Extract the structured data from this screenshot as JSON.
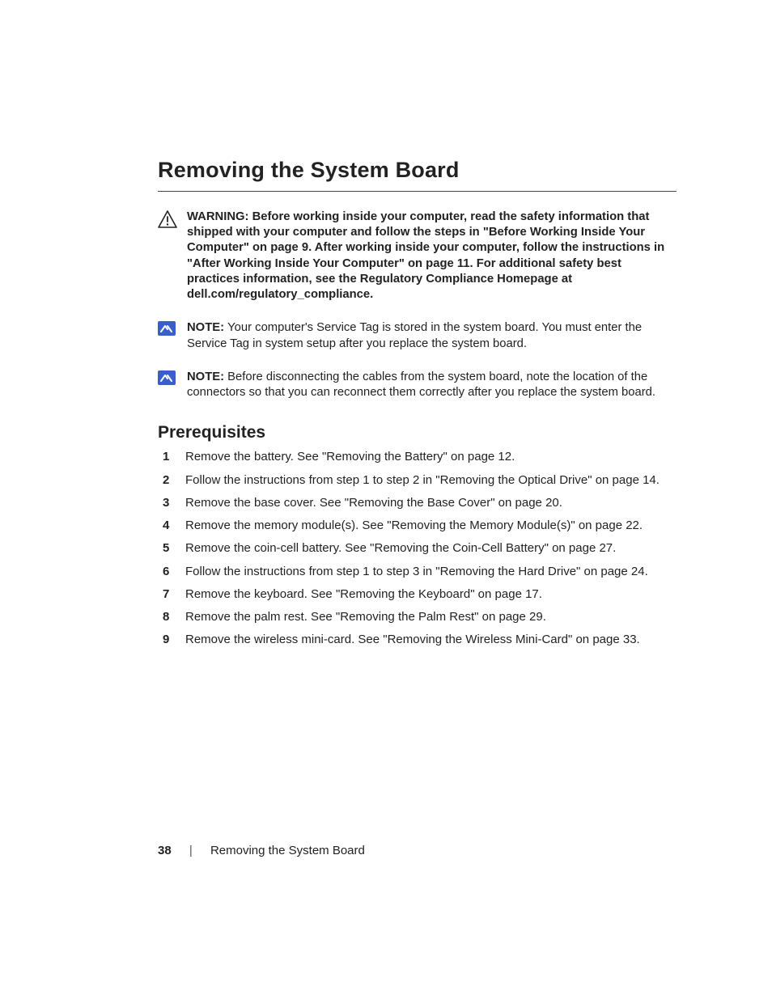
{
  "title": "Removing the System Board",
  "warning": {
    "lead": "WARNING:  ",
    "body": "Before working inside your computer, read the safety information that shipped with your computer and follow the steps in \"Before Working Inside Your Computer\" on page 9. After working inside your computer, follow the instructions in \"After Working Inside Your Computer\" on page 11. For additional safety best practices information, see the Regulatory Compliance Homepage at dell.com/regulatory_compliance."
  },
  "notes": [
    {
      "lead": "NOTE: ",
      "body": "Your computer's Service Tag is stored in the system board. You must enter the Service Tag in system setup after you replace the system board."
    },
    {
      "lead": "NOTE: ",
      "body": "Before disconnecting the cables from the system board, note the location of the connectors so that you can reconnect them correctly after you replace the system board."
    }
  ],
  "prereq_heading": "Prerequisites",
  "steps": [
    "Remove the battery. See \"Removing the Battery\" on page 12.",
    "Follow the instructions from step 1 to step 2 in \"Removing the Optical Drive\" on page 14.",
    "Remove the base cover. See \"Removing the Base Cover\" on page 20.",
    "Remove the memory module(s). See \"Removing the Memory Module(s)\" on page 22.",
    "Remove the coin-cell battery. See \"Removing the Coin-Cell Battery\" on page 27.",
    "Follow the instructions from step 1 to step 3 in \"Removing the Hard Drive\" on page 24.",
    "Remove the keyboard. See \"Removing the Keyboard\" on page 17.",
    "Remove the palm rest. See \"Removing the Palm Rest\" on page 29.",
    "Remove the wireless mini-card. See \"Removing the Wireless Mini-Card\" on page 33."
  ],
  "footer": {
    "page": "38",
    "separator": "|",
    "section": "Removing the System Board"
  }
}
